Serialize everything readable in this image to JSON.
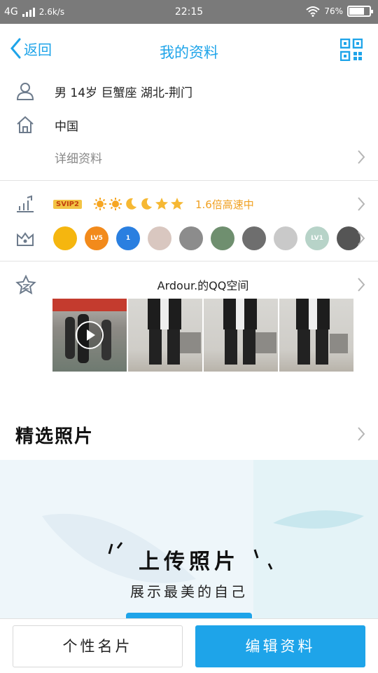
{
  "status_bar": {
    "network": "4G",
    "speed": "2.6k/s",
    "time": "22:15",
    "battery": "76%",
    "battery_level": 0.76
  },
  "header": {
    "back_label": "返回",
    "title": "我的资料",
    "qr_icon": "qr-code-icon"
  },
  "profile": {
    "basic_info": "男  14岁  巨蟹座  湖北-荆门",
    "location": "中国",
    "details_link": "详细资料"
  },
  "vip": {
    "badge": "SVIP2",
    "speed_text": "1.6倍高速中",
    "level_icons": [
      "sun",
      "sun",
      "moon",
      "moon",
      "star",
      "star"
    ]
  },
  "badges": {
    "items": [
      {
        "name": "qq-penguin",
        "label": "",
        "color": "#f5b60f"
      },
      {
        "name": "lightning",
        "label": "LV5",
        "color": "#f28a1b"
      },
      {
        "name": "blue-star",
        "label": "1",
        "color": "#2a7fe0"
      },
      {
        "name": "diamond",
        "label": "",
        "color": "#d9c7c0"
      },
      {
        "name": "penguin-gray",
        "label": "",
        "color": "#8c8c8c"
      },
      {
        "name": "penguin-green",
        "label": "",
        "color": "#6f8f6f"
      },
      {
        "name": "penguin-dark",
        "label": "",
        "color": "#6e6e6e"
      },
      {
        "name": "cloud-v",
        "label": "",
        "color": "#c9c9c9"
      },
      {
        "name": "gem-lv1",
        "label": "LV1",
        "color": "#b7d3c8"
      },
      {
        "name": "penguin-crown",
        "label": "",
        "color": "#555555"
      }
    ]
  },
  "qzone": {
    "title": "Ardour.的QQ空间"
  },
  "featured": {
    "title": "精选照片",
    "upload_title": "上传照片",
    "upload_subtitle": "展示最美的自己"
  },
  "bottom": {
    "card_label": "个性名片",
    "edit_label": "编辑资料"
  },
  "colors": {
    "accent": "#1ea4e9",
    "vip_orange": "#f0a020"
  }
}
